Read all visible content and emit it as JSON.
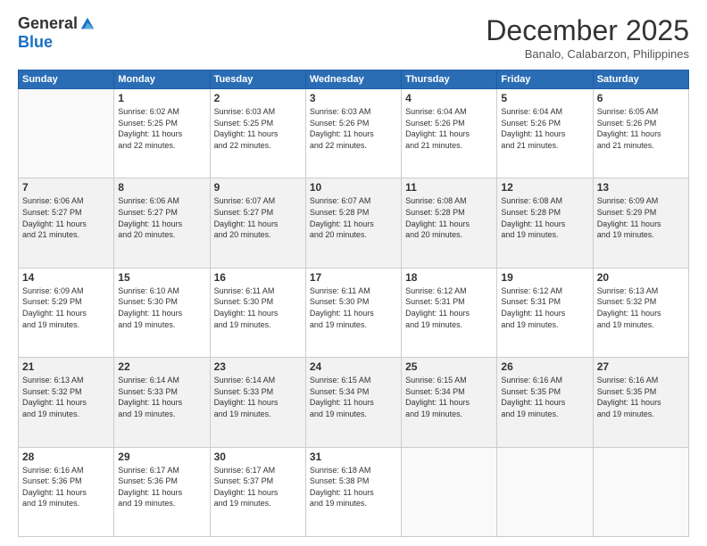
{
  "header": {
    "logo_general": "General",
    "logo_blue": "Blue",
    "title": "December 2025",
    "location": "Banalo, Calabarzon, Philippines"
  },
  "days_of_week": [
    "Sunday",
    "Monday",
    "Tuesday",
    "Wednesday",
    "Thursday",
    "Friday",
    "Saturday"
  ],
  "weeks": [
    [
      {
        "day": "",
        "info": ""
      },
      {
        "day": "1",
        "info": "Sunrise: 6:02 AM\nSunset: 5:25 PM\nDaylight: 11 hours\nand 22 minutes."
      },
      {
        "day": "2",
        "info": "Sunrise: 6:03 AM\nSunset: 5:25 PM\nDaylight: 11 hours\nand 22 minutes."
      },
      {
        "day": "3",
        "info": "Sunrise: 6:03 AM\nSunset: 5:26 PM\nDaylight: 11 hours\nand 22 minutes."
      },
      {
        "day": "4",
        "info": "Sunrise: 6:04 AM\nSunset: 5:26 PM\nDaylight: 11 hours\nand 21 minutes."
      },
      {
        "day": "5",
        "info": "Sunrise: 6:04 AM\nSunset: 5:26 PM\nDaylight: 11 hours\nand 21 minutes."
      },
      {
        "day": "6",
        "info": "Sunrise: 6:05 AM\nSunset: 5:26 PM\nDaylight: 11 hours\nand 21 minutes."
      }
    ],
    [
      {
        "day": "7",
        "info": "Sunrise: 6:06 AM\nSunset: 5:27 PM\nDaylight: 11 hours\nand 21 minutes."
      },
      {
        "day": "8",
        "info": "Sunrise: 6:06 AM\nSunset: 5:27 PM\nDaylight: 11 hours\nand 20 minutes."
      },
      {
        "day": "9",
        "info": "Sunrise: 6:07 AM\nSunset: 5:27 PM\nDaylight: 11 hours\nand 20 minutes."
      },
      {
        "day": "10",
        "info": "Sunrise: 6:07 AM\nSunset: 5:28 PM\nDaylight: 11 hours\nand 20 minutes."
      },
      {
        "day": "11",
        "info": "Sunrise: 6:08 AM\nSunset: 5:28 PM\nDaylight: 11 hours\nand 20 minutes."
      },
      {
        "day": "12",
        "info": "Sunrise: 6:08 AM\nSunset: 5:28 PM\nDaylight: 11 hours\nand 19 minutes."
      },
      {
        "day": "13",
        "info": "Sunrise: 6:09 AM\nSunset: 5:29 PM\nDaylight: 11 hours\nand 19 minutes."
      }
    ],
    [
      {
        "day": "14",
        "info": "Sunrise: 6:09 AM\nSunset: 5:29 PM\nDaylight: 11 hours\nand 19 minutes."
      },
      {
        "day": "15",
        "info": "Sunrise: 6:10 AM\nSunset: 5:30 PM\nDaylight: 11 hours\nand 19 minutes."
      },
      {
        "day": "16",
        "info": "Sunrise: 6:11 AM\nSunset: 5:30 PM\nDaylight: 11 hours\nand 19 minutes."
      },
      {
        "day": "17",
        "info": "Sunrise: 6:11 AM\nSunset: 5:30 PM\nDaylight: 11 hours\nand 19 minutes."
      },
      {
        "day": "18",
        "info": "Sunrise: 6:12 AM\nSunset: 5:31 PM\nDaylight: 11 hours\nand 19 minutes."
      },
      {
        "day": "19",
        "info": "Sunrise: 6:12 AM\nSunset: 5:31 PM\nDaylight: 11 hours\nand 19 minutes."
      },
      {
        "day": "20",
        "info": "Sunrise: 6:13 AM\nSunset: 5:32 PM\nDaylight: 11 hours\nand 19 minutes."
      }
    ],
    [
      {
        "day": "21",
        "info": "Sunrise: 6:13 AM\nSunset: 5:32 PM\nDaylight: 11 hours\nand 19 minutes."
      },
      {
        "day": "22",
        "info": "Sunrise: 6:14 AM\nSunset: 5:33 PM\nDaylight: 11 hours\nand 19 minutes."
      },
      {
        "day": "23",
        "info": "Sunrise: 6:14 AM\nSunset: 5:33 PM\nDaylight: 11 hours\nand 19 minutes."
      },
      {
        "day": "24",
        "info": "Sunrise: 6:15 AM\nSunset: 5:34 PM\nDaylight: 11 hours\nand 19 minutes."
      },
      {
        "day": "25",
        "info": "Sunrise: 6:15 AM\nSunset: 5:34 PM\nDaylight: 11 hours\nand 19 minutes."
      },
      {
        "day": "26",
        "info": "Sunrise: 6:16 AM\nSunset: 5:35 PM\nDaylight: 11 hours\nand 19 minutes."
      },
      {
        "day": "27",
        "info": "Sunrise: 6:16 AM\nSunset: 5:35 PM\nDaylight: 11 hours\nand 19 minutes."
      }
    ],
    [
      {
        "day": "28",
        "info": "Sunrise: 6:16 AM\nSunset: 5:36 PM\nDaylight: 11 hours\nand 19 minutes."
      },
      {
        "day": "29",
        "info": "Sunrise: 6:17 AM\nSunset: 5:36 PM\nDaylight: 11 hours\nand 19 minutes."
      },
      {
        "day": "30",
        "info": "Sunrise: 6:17 AM\nSunset: 5:37 PM\nDaylight: 11 hours\nand 19 minutes."
      },
      {
        "day": "31",
        "info": "Sunrise: 6:18 AM\nSunset: 5:38 PM\nDaylight: 11 hours\nand 19 minutes."
      },
      {
        "day": "",
        "info": ""
      },
      {
        "day": "",
        "info": ""
      },
      {
        "day": "",
        "info": ""
      }
    ]
  ]
}
